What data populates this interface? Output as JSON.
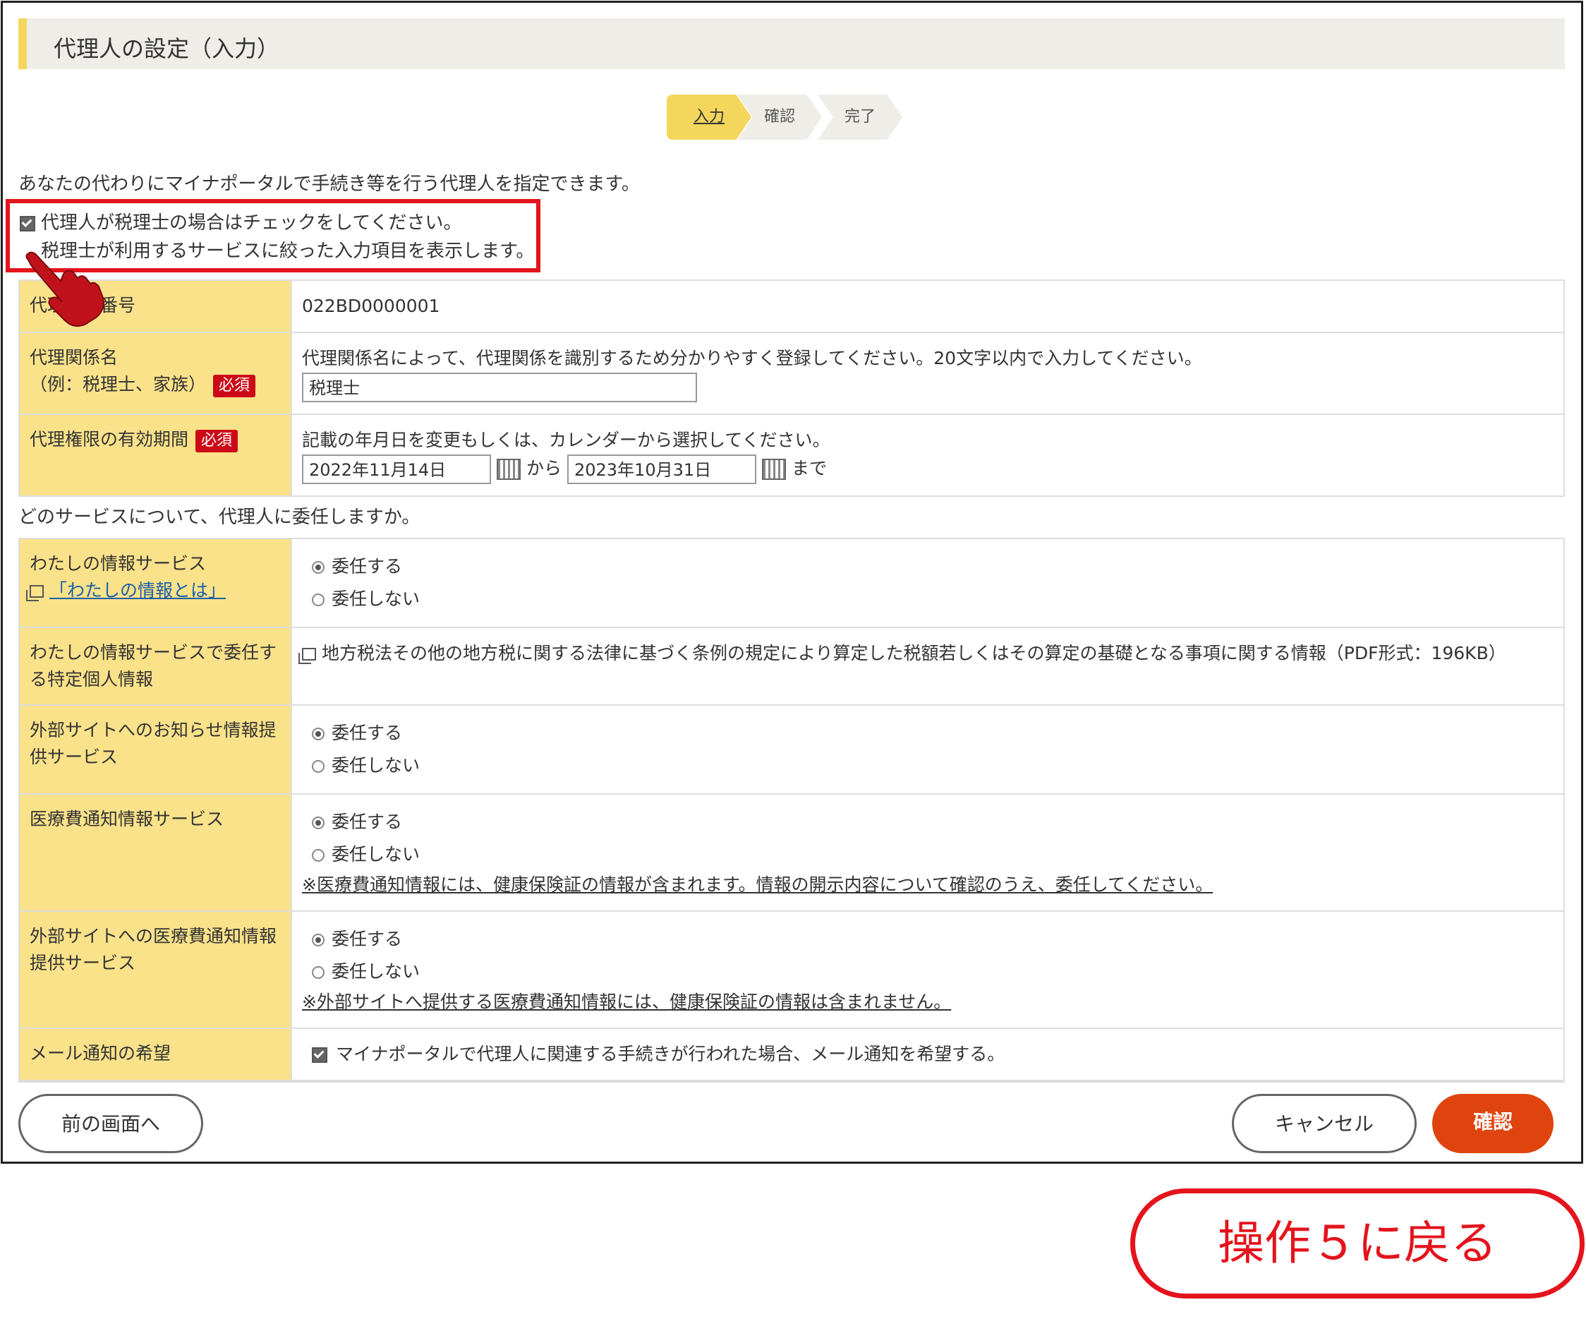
{
  "page": {
    "title": "代理人の設定（入力）"
  },
  "steps": {
    "input": "入力",
    "confirm": "確認",
    "complete": "完了"
  },
  "intro": "あなたの代わりにマイナポータルで手続き等を行う代理人を指定できます。",
  "tax_accountant": {
    "checkbox_label": "代理人が税理士の場合はチェックをしてください。",
    "sub_label": "税理士が利用するサービスに絞った入力項目を表示します。"
  },
  "fields": {
    "number_label": "代理関係番号",
    "number_value": "022BD0000001",
    "relation_label_1": "代理関係名",
    "relation_label_2": "（例：税理士、家族）",
    "required": "必須",
    "relation_help": "代理関係名によって、代理関係を識別するため分かりやすく登録してください。20文字以内で入力してください。",
    "relation_value": "税理士",
    "period_label": "代理権限の有効期間",
    "period_help": "記載の年月日を変更もしくは、カレンダーから選択してください。",
    "start_date": "2022年11月14日",
    "from": "から",
    "end_date": "2023年10月31日",
    "until": "まで"
  },
  "question": "どのサービスについて、代理人に委任しますか。",
  "services": {
    "delegate": "委任する",
    "not_delegate": "委任しない",
    "my_info_label": "わたしの情報サービス",
    "my_info_link": "「わたしの情報とは」",
    "my_info_specific_label": "わたしの情報サービスで委任する特定個人情報",
    "my_info_specific_text": "地方税法その他の地方税に関する法律に基づく条例の規定により算定した税額若しくはその算定の基礎となる事項に関する情報（PDF形式：196KB）",
    "external_notice_label": "外部サイトへのお知らせ情報提供サービス",
    "medical_label": "医療費通知情報サービス",
    "medical_note": "※医療費通知情報には、健康保険証の情報が含まれます。情報の開示内容について確認のうえ、委任してください。",
    "external_medical_label": "外部サイトへの医療費通知情報提供サービス",
    "external_medical_note": "※外部サイトへ提供する医療費通知情報には、健康保険証の情報は含まれません。",
    "mail_label": "メール通知の希望",
    "mail_text": "マイナポータルで代理人に関連する手続きが行われた場合、メール通知を希望する。"
  },
  "buttons": {
    "prev": "前の画面へ",
    "cancel": "キャンセル",
    "confirm": "確認"
  },
  "back_link": "操作５に戻る",
  "colors": {
    "accent": "#f5d65c",
    "label_bg": "#fae28a",
    "required": "#cc0a17",
    "confirm": "#e0440e",
    "highlight": "#e4141c"
  }
}
